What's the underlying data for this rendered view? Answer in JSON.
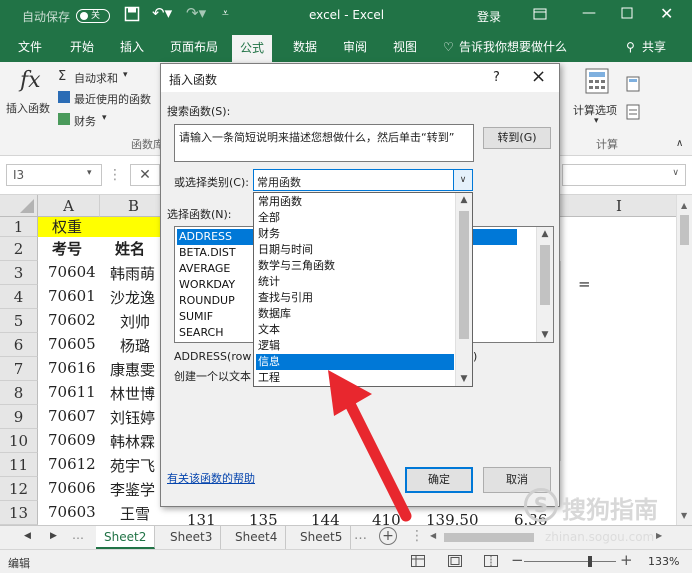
{
  "titlebar": {
    "autosave": "自动保存",
    "toggle": "关",
    "title": "excel  -  Excel",
    "login": "登录"
  },
  "tabs": [
    "文件",
    "开始",
    "插入",
    "页面布局",
    "公式",
    "数据",
    "审阅",
    "视图"
  ],
  "tell_me": "告诉我你想要做什么",
  "share": "共享",
  "ribbon": {
    "fx": "fx",
    "insert_function": "插入函数",
    "autosum": "自动求和",
    "recent": "最近使用的函数",
    "finance": "财务",
    "group_lib": "函数库",
    "calc_options": "计算选项",
    "group_calc": "计算"
  },
  "formula_bar": {
    "name_box": "I3"
  },
  "grid": {
    "col_headers": [
      "A",
      "B",
      "I"
    ],
    "row_numbers": [
      "1",
      "2",
      "3",
      "4",
      "5",
      "6",
      "7",
      "8",
      "9",
      "10",
      "11",
      "12",
      "13"
    ],
    "a1": "权重",
    "a2": "考号",
    "b2": "姓名",
    "col_a": [
      "70604",
      "70601",
      "70602",
      "70605",
      "70616",
      "70611",
      "70607",
      "70609",
      "70612",
      "70606",
      "70603"
    ],
    "col_b": [
      "韩雨萌",
      "沙龙逸",
      "刘帅",
      "杨璐",
      "康惠雯",
      "林世博",
      "刘钰婷",
      "韩林霖",
      "苑宇飞",
      "李鉴学",
      "王雪"
    ],
    "i3": "=",
    "row13_values": [
      "131",
      "135",
      "144",
      "410",
      "139.50",
      "6.36"
    ]
  },
  "sheets": [
    "Sheet2",
    "Sheet3",
    "Sheet4",
    "Sheet5"
  ],
  "status": {
    "mode": "编辑",
    "zoom": "133%"
  },
  "dialog": {
    "title": "插入函数",
    "help_q": "?",
    "close": "×",
    "search_label": "搜索函数(S):",
    "search_text": "请输入一条简短说明来描述您想做什么，然后单击“转到”",
    "goto_button": "转到(G)",
    "category_label": "或选择类别(C):",
    "category_value": "常用函数",
    "select_label": "选择函数(N):",
    "functions": [
      "ADDRESS",
      "BETA.DIST",
      "AVERAGE",
      "WORKDAY",
      "ROUNDUP",
      "SUMIF",
      "SEARCH"
    ],
    "signature": "ADDRESS(row",
    "signature_tail": ")",
    "description": "创建一个以文本",
    "help_link": "有关该函数的帮助",
    "ok": "确定",
    "cancel": "取消",
    "category_options": [
      "常用函数",
      "全部",
      "财务",
      "日期与时间",
      "数学与三角函数",
      "统计",
      "查找与引用",
      "数据库",
      "文本",
      "逻辑",
      "信息",
      "工程"
    ],
    "highlighted_option": "信息"
  },
  "watermark": {
    "brand": "搜狗指南",
    "url": "zhinan.sogou.com"
  },
  "colors": {
    "excel_green": "#217346",
    "selection_blue": "#0078d7",
    "arrow_red": "#e8272e",
    "weight_yellow": "#ffff00"
  }
}
